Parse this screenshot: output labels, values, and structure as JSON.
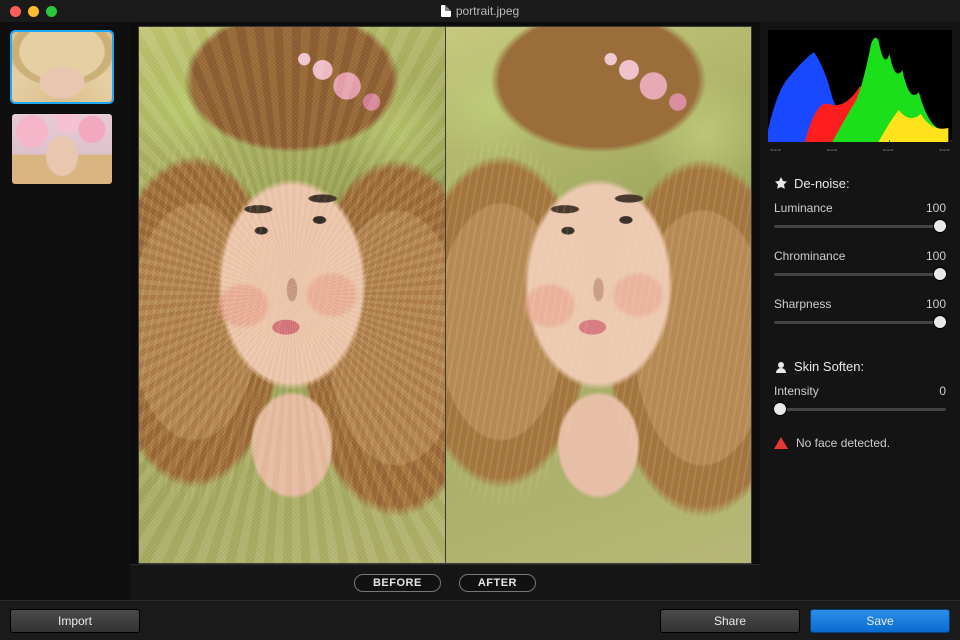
{
  "titlebar": {
    "filename": "portrait.jpeg"
  },
  "thumbnails": [
    {
      "selected": true
    },
    {
      "selected": false
    }
  ],
  "preview": {
    "before_label": "BEFORE",
    "after_label": "AFTER"
  },
  "histogram": {
    "labels": [
      "---",
      "---",
      "---",
      "---"
    ]
  },
  "denoise": {
    "title": "De-noise:",
    "luminance": {
      "label": "Luminance",
      "value": 100,
      "min": 0,
      "max": 100
    },
    "chrominance": {
      "label": "Chrominance",
      "value": 100,
      "min": 0,
      "max": 100
    },
    "sharpness": {
      "label": "Sharpness",
      "value": 100,
      "min": 0,
      "max": 100
    }
  },
  "skin": {
    "title": "Skin Soften:",
    "intensity": {
      "label": "Intensity",
      "value": 0,
      "min": 0,
      "max": 100
    },
    "warning": "No face detected."
  },
  "buttons": {
    "import": "Import",
    "share": "Share",
    "save": "Save"
  }
}
